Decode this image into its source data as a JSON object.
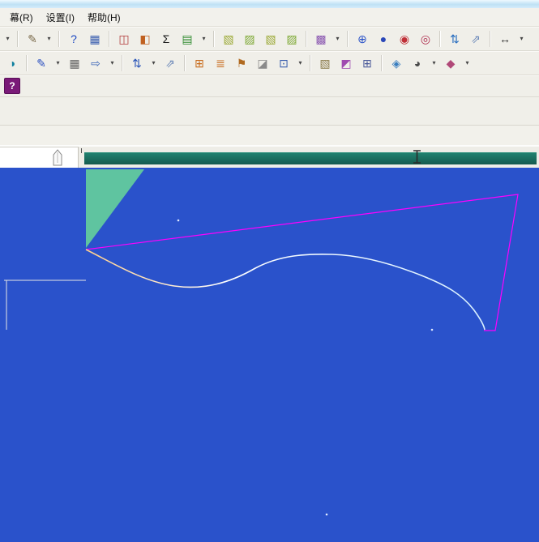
{
  "menubar": {
    "items": [
      {
        "label": "幕(R)"
      },
      {
        "label": "设置(I)"
      },
      {
        "label": "帮助(H)"
      }
    ]
  },
  "toolbars": {
    "row1": [
      {
        "name": "toolbar-overflow-dropdown",
        "glyph": "▾",
        "color": "#444444",
        "dd": true
      },
      {
        "t": "sep"
      },
      {
        "name": "format-brush-icon",
        "glyph": "✎",
        "color": "#7a6a4a"
      },
      {
        "name": "format-brush-dropdown",
        "glyph": "▾",
        "color": "#444444",
        "dd": true
      },
      {
        "t": "sep"
      },
      {
        "name": "context-help-icon",
        "glyph": "?",
        "color": "#1d49c2"
      },
      {
        "name": "snap-grid-icon",
        "glyph": "▦",
        "color": "#3b5fb0"
      },
      {
        "t": "sep"
      },
      {
        "name": "histogram-icon",
        "glyph": "◫",
        "color": "#b03838"
      },
      {
        "name": "area-chart-icon",
        "glyph": "◧",
        "color": "#c06020"
      },
      {
        "name": "sum-icon",
        "glyph": "Σ",
        "color": "#1a1a1a"
      },
      {
        "name": "export-report-icon",
        "glyph": "▤",
        "color": "#2e8b2e"
      },
      {
        "name": "export-report-dropdown",
        "glyph": "▾",
        "color": "#444444",
        "dd": true
      },
      {
        "t": "sep"
      },
      {
        "name": "view-iso-icon",
        "glyph": "▧",
        "color": "#9aa832"
      },
      {
        "name": "view-front-icon",
        "glyph": "▨",
        "color": "#7ca832"
      },
      {
        "name": "view-side-icon",
        "glyph": "▧",
        "color": "#9aa832"
      },
      {
        "name": "view-top-icon",
        "glyph": "▨",
        "color": "#7ca832"
      },
      {
        "t": "sep"
      },
      {
        "name": "solid-view-icon",
        "glyph": "▩",
        "color": "#8a56b0"
      },
      {
        "name": "solid-view-dropdown",
        "glyph": "▾",
        "color": "#444444",
        "dd": true
      },
      {
        "t": "sep"
      },
      {
        "name": "wireframe-globe-icon",
        "glyph": "⊕",
        "color": "#2a52c8"
      },
      {
        "name": "shaded-sphere-icon",
        "glyph": "●",
        "color": "#2a47b8"
      },
      {
        "name": "material-sphere-icon",
        "glyph": "◉",
        "color": "#c03038"
      },
      {
        "name": "material-sphere-alt-icon",
        "glyph": "◎",
        "color": "#b03050"
      },
      {
        "t": "sep"
      },
      {
        "name": "swap-vertical-icon",
        "glyph": "⇅",
        "color": "#2a6fc0"
      },
      {
        "name": "move-diagonal-icon",
        "glyph": "⇗",
        "color": "#6a87b8"
      },
      {
        "t": "sep"
      },
      {
        "name": "fit-width-icon",
        "glyph": "↔",
        "color": "#333333"
      },
      {
        "name": "fit-width-dropdown",
        "glyph": "▾",
        "color": "#444444",
        "dd": true
      }
    ],
    "row2": [
      {
        "name": "fill-style-icon",
        "glyph": "◑",
        "color": "#0e7f9e"
      },
      {
        "t": "sep"
      },
      {
        "name": "draw-pen-icon",
        "glyph": "✎",
        "color": "#2a4fc0"
      },
      {
        "name": "draw-pen-dropdown",
        "glyph": "▾",
        "color": "#444444",
        "dd": true
      },
      {
        "name": "tile-grid-icon",
        "glyph": "▦",
        "color": "#666666"
      },
      {
        "name": "send-to-icon",
        "glyph": "⇨",
        "color": "#3a66b8"
      },
      {
        "name": "send-to-dropdown",
        "glyph": "▾",
        "color": "#444444",
        "dd": true
      },
      {
        "t": "sep"
      },
      {
        "name": "sort-updown-icon",
        "glyph": "⇅",
        "color": "#2a55b8"
      },
      {
        "name": "sort-updown-dropdown",
        "glyph": "▾",
        "color": "#444444",
        "dd": true
      },
      {
        "name": "jump-diagonal-icon",
        "glyph": "⇗",
        "color": "#6a87b8"
      },
      {
        "t": "sep"
      },
      {
        "name": "table-grid-icon",
        "glyph": "⊞",
        "color": "#c86a1a"
      },
      {
        "name": "row-lines-icon",
        "glyph": "≣",
        "color": "#c86a1a"
      },
      {
        "name": "flag-marker-icon",
        "glyph": "⚑",
        "color": "#b06a20"
      },
      {
        "name": "eraser-icon",
        "glyph": "◪",
        "color": "#8a8a8a"
      },
      {
        "name": "new-window-icon",
        "glyph": "⊡",
        "color": "#3a5fae"
      },
      {
        "name": "new-window-dropdown",
        "glyph": "▾",
        "color": "#444444",
        "dd": true
      },
      {
        "t": "sep"
      },
      {
        "name": "block-cube-icon",
        "glyph": "▧",
        "color": "#8a7a4a"
      },
      {
        "name": "render-shade-icon",
        "glyph": "◩",
        "color": "#a04ab0"
      },
      {
        "name": "pane-grid-icon",
        "glyph": "⊞",
        "color": "#4a5a9a"
      },
      {
        "t": "sep"
      },
      {
        "name": "layer-stack-icon",
        "glyph": "◈",
        "color": "#3a7fc0"
      },
      {
        "name": "display-mode-icon",
        "glyph": "◕",
        "color": "#4a4a4a"
      },
      {
        "name": "display-mode-dropdown",
        "glyph": "▾",
        "color": "#444444",
        "dd": true
      },
      {
        "name": "ink-bottle-icon",
        "glyph": "◆",
        "color": "#b04878"
      },
      {
        "name": "toolbar-options-dropdown",
        "glyph": "▾",
        "color": "#444444",
        "dd": true
      }
    ],
    "row3": [
      {
        "name": "query-tool-icon",
        "glyph": "?",
        "color": "#ffffff",
        "bg": "#7a1a78"
      }
    ]
  },
  "canvas": {
    "colors": {
      "background": "#2a52cb",
      "highlight_fill": "#5fc4a0",
      "selection_stroke": "#ff00ff",
      "curve_start": "#ffcf8a",
      "curve_mid": "#ffffff",
      "curve_end": "#d8f0ff",
      "guide_stroke": "#e6e6e6",
      "marker_dot": "#dfe9ff",
      "teal_band": "#186a5e"
    }
  }
}
